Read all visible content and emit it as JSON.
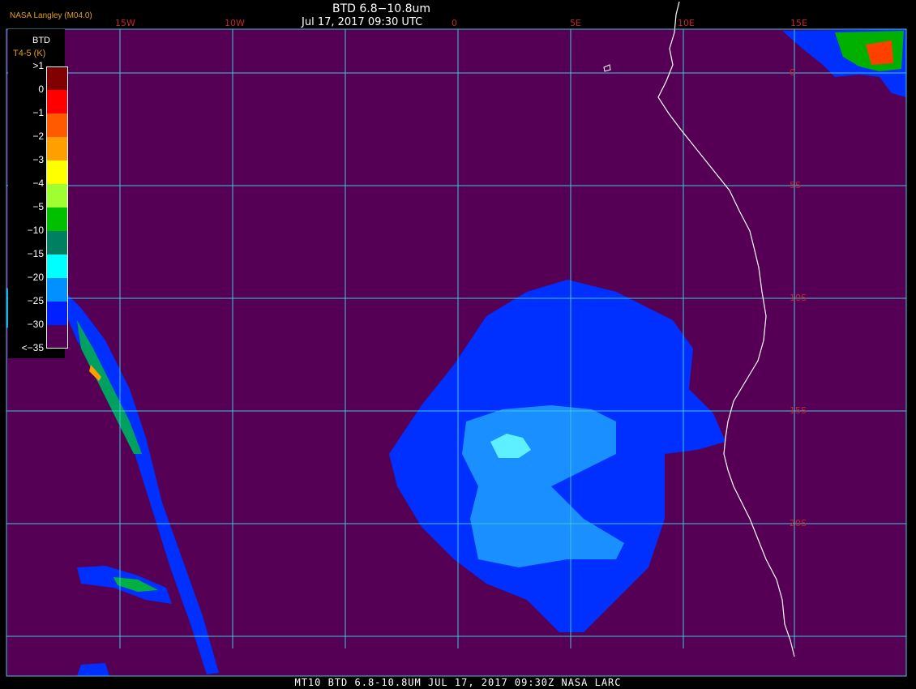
{
  "header": {
    "title": "BTD 6.8−10.8um",
    "datetime": "Jul 17, 2017 09:30 UTC",
    "credit": "NASA Langley (M04.0)"
  },
  "footer": {
    "caption": "MT10  BTD 6.8-10.8UM   JUL 17, 2017 09:30Z   NASA LARC"
  },
  "map": {
    "background_color": "#550055",
    "grid_color": "#3fc6dc",
    "coast_color": "#ffffff",
    "label_color": "#c0282b",
    "longitude_labels": [
      "15W",
      "10W",
      "0",
      "5E",
      "10E",
      "15E"
    ],
    "latitude_labels": [
      "0",
      "5S",
      "10S",
      "15S",
      "20S"
    ]
  },
  "legend": {
    "title": "BTD",
    "subtitle": "T4-5 (K)",
    "ticks": [
      ">1",
      "0",
      "−1",
      "−2",
      "−3",
      "−4",
      "−5",
      "−10",
      "−15",
      "−20",
      "−25",
      "−30",
      "<−35"
    ],
    "colors": [
      "#800000",
      "#ff0000",
      "#ff5a00",
      "#ffa000",
      "#ffff00",
      "#a0ff30",
      "#00c000",
      "#008060",
      "#00ffff",
      "#0090ff",
      "#0020ff",
      "#550055"
    ]
  }
}
